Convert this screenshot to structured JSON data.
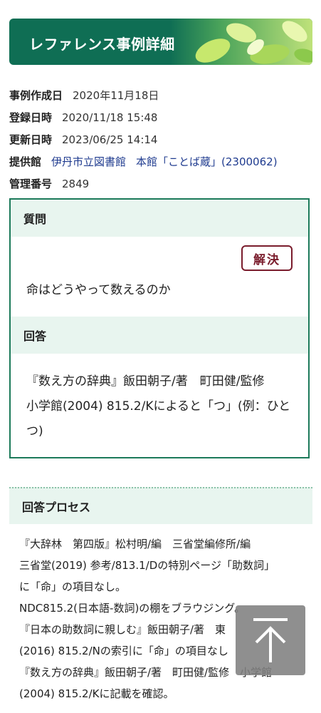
{
  "header": {
    "title": "レファレンス事例詳細"
  },
  "meta": {
    "created_label": "事例作成日",
    "created_value": "2020年11月18日",
    "registered_label": "登録日時",
    "registered_value": "2020/11/18 15:48",
    "updated_label": "更新日時",
    "updated_value": "2023/06/25 14:14",
    "provider_label": "提供館",
    "provider_library": "伊丹市立図書館",
    "provider_branch": "本館「ことば蔵」(2300062)",
    "id_label": "管理番号",
    "id_value": "2849"
  },
  "question": {
    "heading": "質問",
    "status": "解決",
    "text": "命はどうやって数えるのか"
  },
  "answer": {
    "heading": "回答",
    "line1": "『数え方の辞典』飯田朝子/著　町田健/監修",
    "line2": "小学館(2004) 815.2/Kによると「つ」(例：ひと",
    "line3": "つ)"
  },
  "process": {
    "heading": "回答プロセス",
    "lines": [
      "『大辞林　第四版』松村明/編　三省堂編修所/編",
      "三省堂(2019) 参考/813.1/Dの特別ページ「助数詞」",
      "に「命」の項目なし。",
      "NDC815.2(日本語-数詞)の棚をブラウジング。",
      "『日本の助数詞に親しむ』飯田朝子/著　東",
      "(2016) 815.2/Nの索引に「命」の項目なし",
      "『数え方の辞典』飯田朝子/著　町田健/監修　小学館",
      "(2004) 815.2/Kに記載を確認。"
    ]
  },
  "icons": {
    "scroll_top": "arrow-up-icon"
  }
}
